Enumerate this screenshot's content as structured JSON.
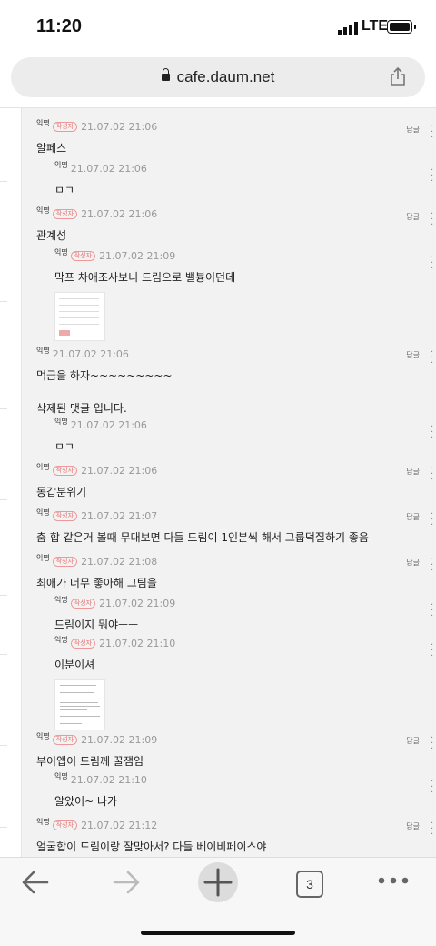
{
  "status": {
    "time": "11:20",
    "network": "LTE"
  },
  "browser": {
    "url": "cafe.daum.net"
  },
  "reply_label": "답글",
  "badge_label": "작성자",
  "comments": [
    {
      "author": "익명",
      "badge": true,
      "time": "21.07.02 21:06",
      "text": "알페스",
      "reply": true
    },
    {
      "author": "익명",
      "badge": false,
      "time": "21.07.02 21:06",
      "text": "ㅁㄱ",
      "reply": false
    },
    {
      "author": "익명",
      "badge": true,
      "time": "21.07.02 21:06",
      "text": "관계성",
      "reply": true
    },
    {
      "author": "익명",
      "badge": true,
      "time": "21.07.02 21:09",
      "text": "막프 차애조사보니 드림으로 밸븅이던데",
      "reply": false
    },
    {
      "author": "익명",
      "badge": false,
      "time": "21.07.02 21:06",
      "text": "먹금을 하자~~~~~~~~~",
      "reply": true
    },
    {
      "deleted_text": "삭제된 댓글 입니다."
    },
    {
      "author": "익명",
      "badge": false,
      "time": "21.07.02 21:06",
      "text": "ㅁㄱ",
      "reply": false
    },
    {
      "author": "익명",
      "badge": true,
      "time": "21.07.02 21:06",
      "text": "동갑분위기",
      "reply": true
    },
    {
      "author": "익명",
      "badge": true,
      "time": "21.07.02 21:07",
      "text": "춤 합 같은거 볼때 무대보면 다들 드림이 1인분씩 해서 그룹덕질하기 좋음",
      "reply": true
    },
    {
      "author": "익명",
      "badge": true,
      "time": "21.07.02 21:08",
      "text": "최애가 너무 좋아해 그팀을",
      "reply": true
    },
    {
      "author": "익명",
      "badge": true,
      "time": "21.07.02 21:09",
      "text": "드림이지 뭐야ㅡㅡ",
      "reply": false
    },
    {
      "author": "익명",
      "badge": true,
      "time": "21.07.02 21:10",
      "text": "이분이셔",
      "reply": false
    },
    {
      "author": "익명",
      "badge": true,
      "time": "21.07.02 21:09",
      "text": "부이앱이 드림께 꿀잼임",
      "reply": true
    },
    {
      "author": "익명",
      "badge": false,
      "time": "21.07.02 21:10",
      "text": "알았어~ 나가",
      "reply": false
    },
    {
      "author": "익명",
      "badge": true,
      "time": "21.07.02 21:12",
      "text": "얼굴합이 드림이랑 잘맞아서? 다들 베이비페이스야",
      "reply": true
    }
  ],
  "toolbar": {
    "tab_count": "3"
  }
}
